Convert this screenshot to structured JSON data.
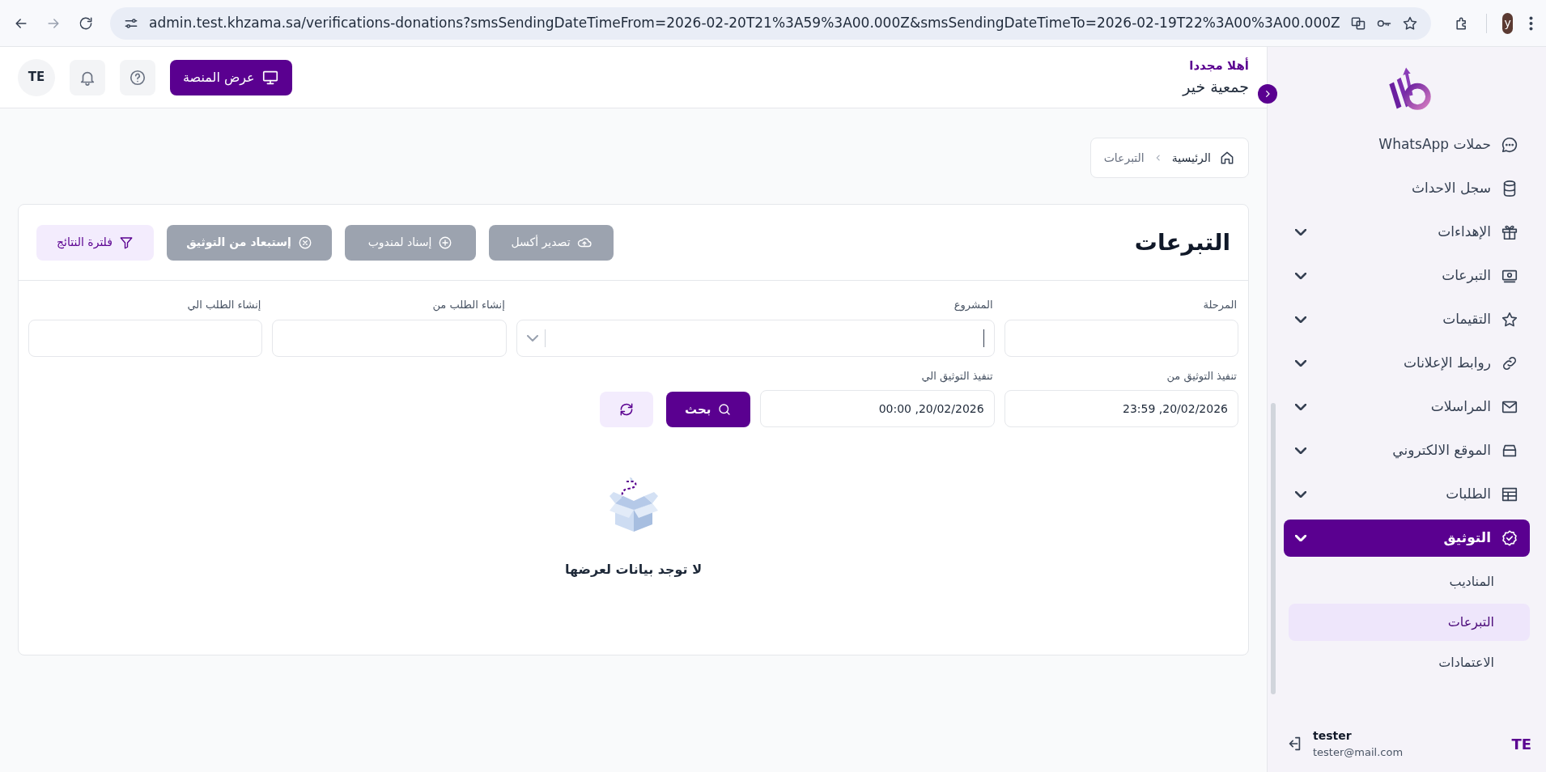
{
  "browser": {
    "url": "admin.test.khzama.sa/verifications-donations?smsSendingDateTimeFrom=2026-02-20T21%3A59%3A00.000Z&smsSendingDateTimeTo=2026-02-19T22%3A00%3A00.000Z",
    "profile_initial": "y"
  },
  "header": {
    "greeting": "أهلا مجددا",
    "organization": "جمعية خير",
    "platform_button": "عرض المنصة",
    "avatar": "TE"
  },
  "breadcrumb": [
    {
      "label": "الرئيسية",
      "current": false
    },
    {
      "label": "التبرعات",
      "current": true
    }
  ],
  "page": {
    "title": "التبرعات",
    "actions": [
      {
        "label": "تصدير أكسل",
        "disabled": true,
        "kind": "export"
      },
      {
        "label": "إسناد لمندوب",
        "disabled": true,
        "kind": "assign"
      },
      {
        "label": "إستبعاد من التوثيق",
        "disabled": true,
        "kind": "exclude"
      },
      {
        "label": "فلترة النتائج",
        "disabled": false,
        "kind": "filter"
      }
    ],
    "filters": [
      {
        "label": "المرحلة",
        "kind": "text"
      },
      {
        "label": "المشروع",
        "kind": "select"
      },
      {
        "label": "إنشاء الطلب من",
        "kind": "text"
      },
      {
        "label": "إنشاء الطلب الي",
        "kind": "text"
      },
      {
        "label": "تنفيذ التوثيق من",
        "kind": "text",
        "value": "20/02/2026, 23:59"
      },
      {
        "label": "تنفيذ التوثيق الي",
        "kind": "text",
        "value": "20/02/2026, 00:00"
      }
    ],
    "search_button": "بحث",
    "empty_message": "لا توجد بيانات لعرضها"
  },
  "sidebar": {
    "items": [
      {
        "label": "حملات WhatsApp",
        "expandable": false,
        "selected": false
      },
      {
        "label": "سجل الاحداث",
        "expandable": false,
        "selected": false
      },
      {
        "label": "الإهداءات",
        "expandable": true,
        "selected": false
      },
      {
        "label": "التبرعات",
        "expandable": true,
        "selected": false
      },
      {
        "label": "التقيمات",
        "expandable": true,
        "selected": false
      },
      {
        "label": "روابط الإعلانات",
        "expandable": true,
        "selected": false
      },
      {
        "label": "المراسلات",
        "expandable": true,
        "selected": false
      },
      {
        "label": "الموقع الالكتروني",
        "expandable": true,
        "selected": false
      },
      {
        "label": "الطلبات",
        "expandable": true,
        "selected": false
      },
      {
        "label": "التوثيق",
        "expandable": true,
        "selected": true,
        "children": [
          {
            "label": "المناديب",
            "selected": false
          },
          {
            "label": "التبرعات",
            "selected": true
          },
          {
            "label": "الاعتمادات",
            "selected": false
          }
        ]
      }
    ],
    "user": {
      "avatar": "TE",
      "name": "tester",
      "email": "tester@mail.com"
    }
  }
}
